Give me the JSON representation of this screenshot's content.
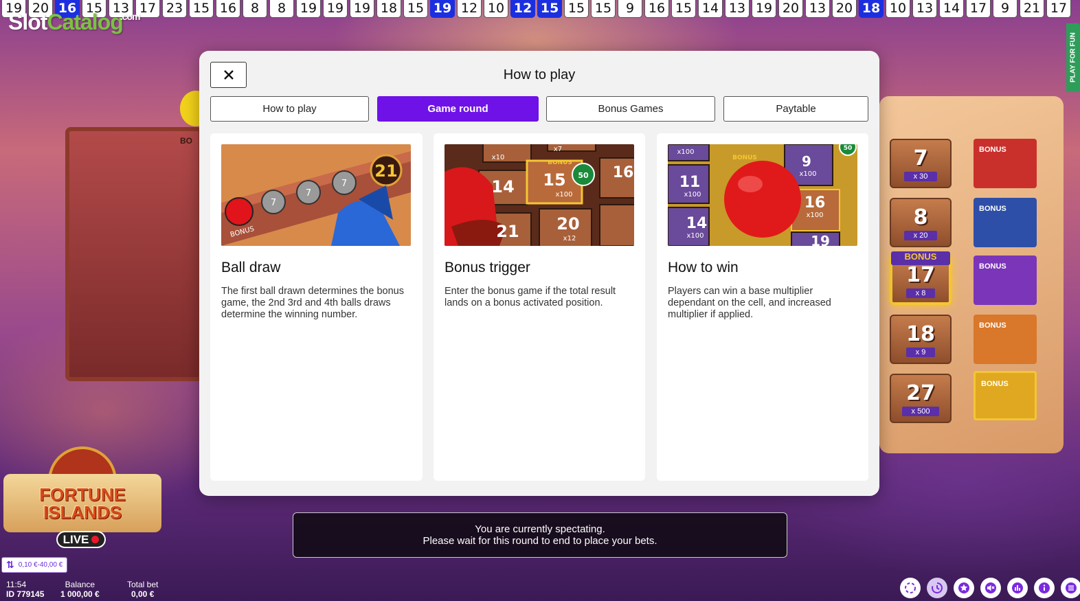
{
  "history": [
    {
      "n": "19",
      "hl": false
    },
    {
      "n": "20",
      "hl": false
    },
    {
      "n": "16",
      "hl": true
    },
    {
      "n": "15",
      "hl": false
    },
    {
      "n": "13",
      "hl": false
    },
    {
      "n": "17",
      "hl": false
    },
    {
      "n": "23",
      "hl": false
    },
    {
      "n": "15",
      "hl": false
    },
    {
      "n": "16",
      "hl": false
    },
    {
      "n": "8",
      "hl": false
    },
    {
      "n": "8",
      "hl": false
    },
    {
      "n": "19",
      "hl": false
    },
    {
      "n": "19",
      "hl": false
    },
    {
      "n": "19",
      "hl": false
    },
    {
      "n": "18",
      "hl": false
    },
    {
      "n": "15",
      "hl": false
    },
    {
      "n": "19",
      "hl": true
    },
    {
      "n": "12",
      "hl": false
    },
    {
      "n": "10",
      "hl": false
    },
    {
      "n": "12",
      "hl": true
    },
    {
      "n": "15",
      "hl": true
    },
    {
      "n": "15",
      "hl": false
    },
    {
      "n": "15",
      "hl": false
    },
    {
      "n": "9",
      "hl": false
    },
    {
      "n": "16",
      "hl": false
    },
    {
      "n": "15",
      "hl": false
    },
    {
      "n": "14",
      "hl": false
    },
    {
      "n": "13",
      "hl": false
    },
    {
      "n": "19",
      "hl": false
    },
    {
      "n": "20",
      "hl": false
    },
    {
      "n": "13",
      "hl": false
    },
    {
      "n": "20",
      "hl": false
    },
    {
      "n": "18",
      "hl": true
    },
    {
      "n": "10",
      "hl": false
    },
    {
      "n": "13",
      "hl": false
    },
    {
      "n": "14",
      "hl": false
    },
    {
      "n": "17",
      "hl": false
    },
    {
      "n": "9",
      "hl": false
    },
    {
      "n": "21",
      "hl": false
    },
    {
      "n": "17",
      "hl": false
    }
  ],
  "watermark": {
    "slot": "Slot",
    "catalog": "Catalog",
    "com": ".com"
  },
  "play_for_fun": "PLAY FOR FUN",
  "left_board_label": "BO",
  "modal": {
    "title": "How to play",
    "tabs": [
      "How to play",
      "Game round",
      "Bonus Games",
      "Paytable"
    ],
    "active_tab": 1,
    "cards": [
      {
        "title": "Ball draw",
        "text": "The first ball drawn determines the bonus game, the 2nd 3rd and 4th balls draws determine the winning number.",
        "img_labels": {
          "big": "21",
          "small": "7",
          "bonus": "BONUS"
        }
      },
      {
        "title": "Bonus trigger",
        "text": "Enter the bonus game if the total result lands on a bonus activated position.",
        "img_labels": {
          "n14": "14",
          "n15": "15",
          "n16": "16",
          "n21": "21",
          "n20": "20",
          "m100": "x100",
          "m12": "x12",
          "m10": "x10",
          "m7": "x7",
          "bonus": "BONUS",
          "chip": "50"
        }
      },
      {
        "title": "How to win",
        "text": "Players can win a base multiplier dependant on the cell, and increased multiplier if applied.",
        "img_labels": {
          "n11": "11",
          "n14": "14",
          "n9": "9",
          "n16": "16",
          "n19": "19",
          "m100": "x100",
          "bonus": "BONUS",
          "chip": "50"
        }
      }
    ]
  },
  "paytable_board": [
    {
      "num": "7",
      "mult": "x 30"
    },
    {
      "num": "8",
      "mult": "x 20"
    },
    {
      "num": "17",
      "mult": "x 8",
      "gold": true
    },
    {
      "num": "18",
      "mult": "x 9"
    },
    {
      "num": "27",
      "mult": "x 500"
    }
  ],
  "gold_tag": "BONUS",
  "bonus_cells": [
    {
      "label": "BONUS",
      "color": "#c9302c"
    },
    {
      "label": "BONUS",
      "color": "#2d4fa8"
    },
    {
      "label": "BONUS",
      "color": "#7b35b8"
    },
    {
      "label": "BONUS",
      "color": "#d9772a"
    },
    {
      "label": "BONUS",
      "color": "#e0a820"
    }
  ],
  "game_logo": {
    "line1": "FORTUNE",
    "line2": "ISLANDS",
    "live": "LIVE"
  },
  "spectate": {
    "line1": "You are currently spectating.",
    "line2": "Please wait for this round to end to place your bets."
  },
  "limits": "0,10 €-40,00 €",
  "status": {
    "time": "11:54",
    "id": "ID 779145",
    "balance_label": "Balance",
    "balance_value": "1 000,00 €",
    "totalbet_label": "Total bet",
    "totalbet_value": "0,00 €"
  },
  "bottom_icons": [
    "fullscreen-icon",
    "history-icon",
    "favorite-star-icon",
    "sound-muted-icon",
    "statistics-icon",
    "info-icon",
    "menu-icon"
  ],
  "colors": {
    "accent": "#6f12e8",
    "history_highlight": "#1b2fe0"
  }
}
